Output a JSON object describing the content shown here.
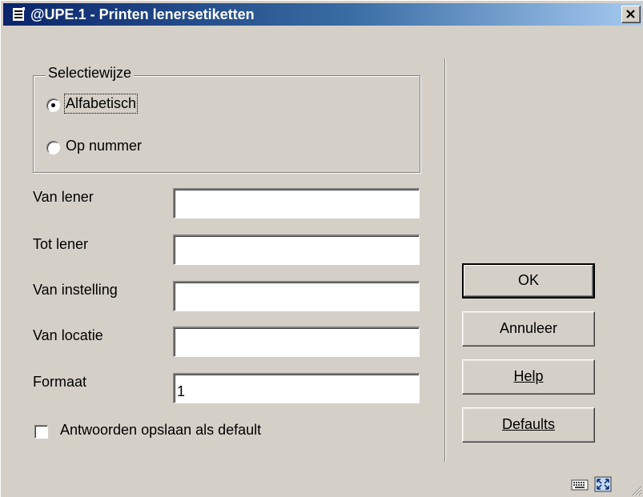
{
  "window": {
    "title": "@UPE.1 - Printen lenersetiketten",
    "close_label": "×"
  },
  "selection": {
    "legend": "Selectiewijze",
    "options": [
      {
        "label": "Alfabetisch",
        "selected": true
      },
      {
        "label": "Op nummer",
        "selected": false
      }
    ]
  },
  "fields": [
    {
      "label": "Van lener",
      "value": ""
    },
    {
      "label": "Tot lener",
      "value": ""
    },
    {
      "label": "Van instelling",
      "value": ""
    },
    {
      "label": "Van locatie",
      "value": ""
    },
    {
      "label": "Formaat",
      "value": "1"
    }
  ],
  "save_default": {
    "label": "Antwoorden opslaan als default",
    "checked": false
  },
  "buttons": {
    "ok": "OK",
    "cancel": "Annuleer",
    "help": "Help",
    "defaults": "Defaults"
  },
  "status_icons": [
    "keyboard-icon",
    "expand-icon"
  ]
}
